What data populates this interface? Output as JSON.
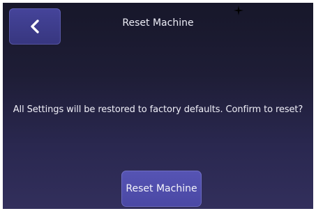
{
  "header": {
    "title": "Reset Machine",
    "back_icon": "chevron-left-icon"
  },
  "dialog": {
    "message": "All Settings will be restored to factory defaults. Confirm to reset?",
    "confirm_label": "Reset Machine"
  },
  "colors": {
    "background_top": "#17172a",
    "background_bottom": "#322f5c",
    "button": "#4a48a4",
    "text": "#f0f0f8"
  }
}
